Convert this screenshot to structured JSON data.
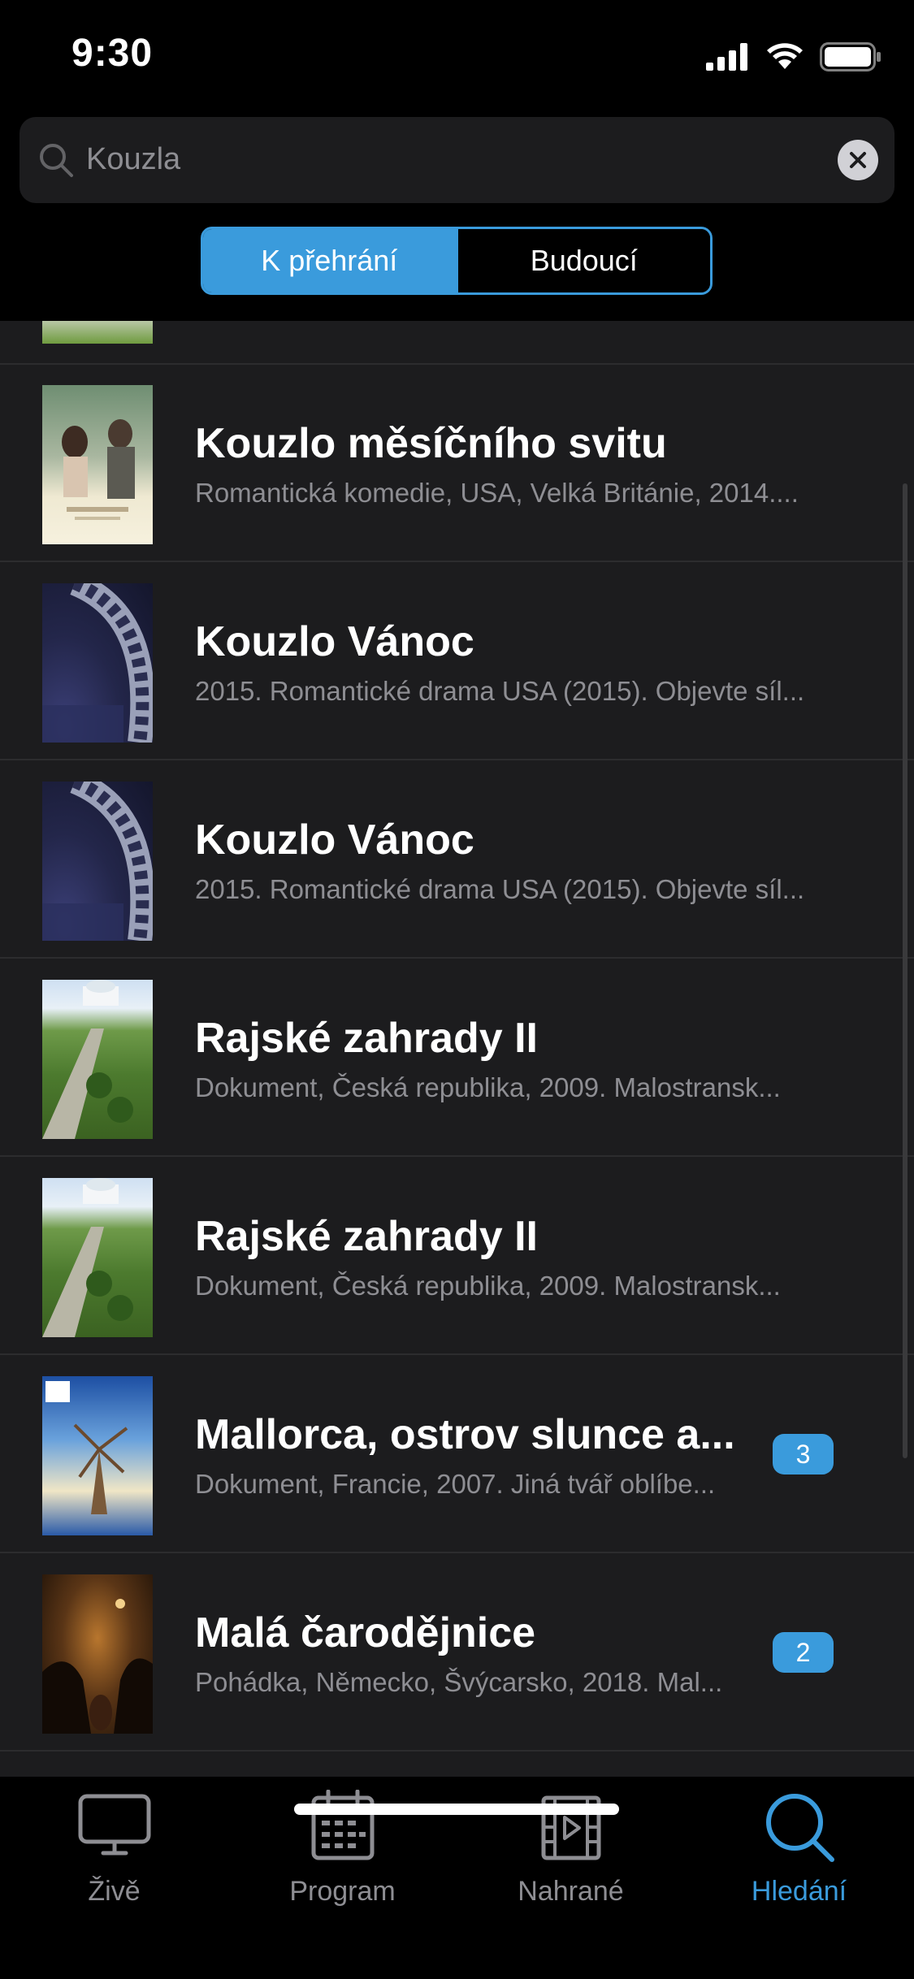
{
  "status_bar": {
    "time": "9:30"
  },
  "search": {
    "query": "Kouzla"
  },
  "segments": [
    {
      "label": "K přehrání",
      "active": true
    },
    {
      "label": "Budoucí",
      "active": false
    }
  ],
  "results": [
    {
      "title": "Kouzlo měsíčního svitu",
      "description": "Romantická komedie, USA, Velká Británie, 2014....",
      "badge": ""
    },
    {
      "title": "Kouzlo Vánoc",
      "description": "2015. Romantické drama USA (2015). Objevte síl...",
      "badge": ""
    },
    {
      "title": "Kouzlo Vánoc",
      "description": "2015. Romantické drama USA (2015). Objevte síl...",
      "badge": ""
    },
    {
      "title": "Rajské zahrady II",
      "description": "Dokument, Česká republika, 2009. Malostransk...",
      "badge": ""
    },
    {
      "title": "Rajské zahrady II",
      "description": "Dokument, Česká republika, 2009. Malostransk...",
      "badge": ""
    },
    {
      "title": "Mallorca, ostrov slunce a...",
      "description": "Dokument, Francie, 2007. Jiná tvář oblíbe...",
      "badge": "3"
    },
    {
      "title": "Malá čarodějnice",
      "description": "Pohádka, Německo, Švýcarsko, 2018. Mal...",
      "badge": "2"
    }
  ],
  "tabs": [
    {
      "label": "Živě",
      "icon": "tv-icon",
      "active": false
    },
    {
      "label": "Program",
      "icon": "calendar-icon",
      "active": false
    },
    {
      "label": "Nahrané",
      "icon": "film-play-icon",
      "active": false
    },
    {
      "label": "Hledání",
      "icon": "search-icon",
      "active": true
    }
  ],
  "colors": {
    "accent": "#3a9bdc",
    "list_bg": "#1c1c1e",
    "muted_text": "#8e8e93"
  }
}
